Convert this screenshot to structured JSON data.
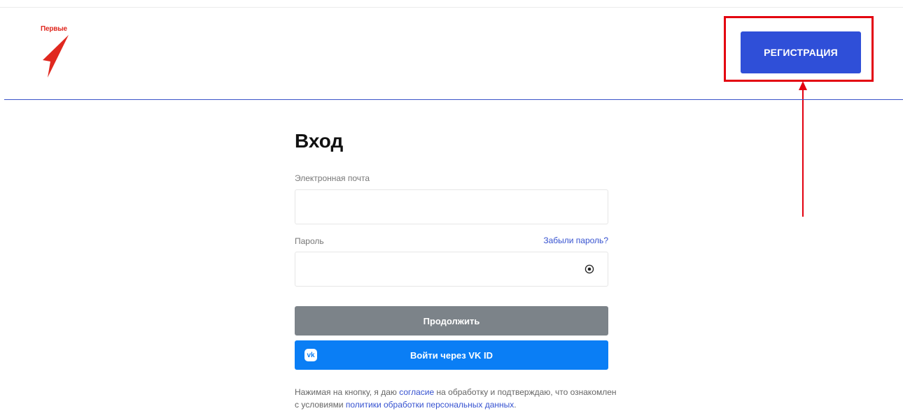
{
  "logo": {
    "text": "Первые",
    "icon": "arrow-logo-icon",
    "color": "#e0281f"
  },
  "header": {
    "register_label": "РЕГИСТРАЦИЯ",
    "accent": "#2f4fd8"
  },
  "annotation": {
    "color": "#e3000f"
  },
  "login": {
    "title": "Вход",
    "email_label": "Электронная почта",
    "email_value": "",
    "password_label": "Пароль",
    "password_value": "",
    "forgot_label": "Забыли пароль?",
    "continue_label": "Продолжить",
    "vk_label": "Войти через VK ID",
    "vk_icon": "vk-icon"
  },
  "consent": {
    "part1": "Нажимая на кнопку, я даю ",
    "link1": "согласие",
    "part2": " на обработку и подтверждаю, что ознакомлен с условиями ",
    "link2": "политики обработки персональных данных",
    "part3": "."
  }
}
